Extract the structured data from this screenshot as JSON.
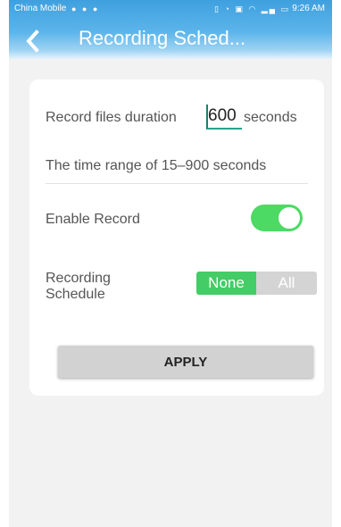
{
  "status_bar": {
    "carrier": "China Mobile",
    "time": "9:26 AM"
  },
  "nav": {
    "back_icon": "chevron-left-icon",
    "title": "Recording Sched..."
  },
  "record_duration": {
    "label": "Record files duration",
    "value": "600",
    "unit": "seconds",
    "range_hint": "The time range of 15–900 seconds"
  },
  "enable_record": {
    "label": "Enable Record",
    "enabled": true
  },
  "recording_schedule": {
    "label": "Recording Schedule",
    "options": [
      "None",
      "All"
    ],
    "selected": "None"
  },
  "apply_button": {
    "label": "APPLY"
  },
  "colors": {
    "header": "#3fa0df",
    "toggle_on": "#4cd964",
    "segment_selected": "#44cc66",
    "segment_unselected": "#d4d4d4",
    "input_underline": "#2aa08a"
  }
}
